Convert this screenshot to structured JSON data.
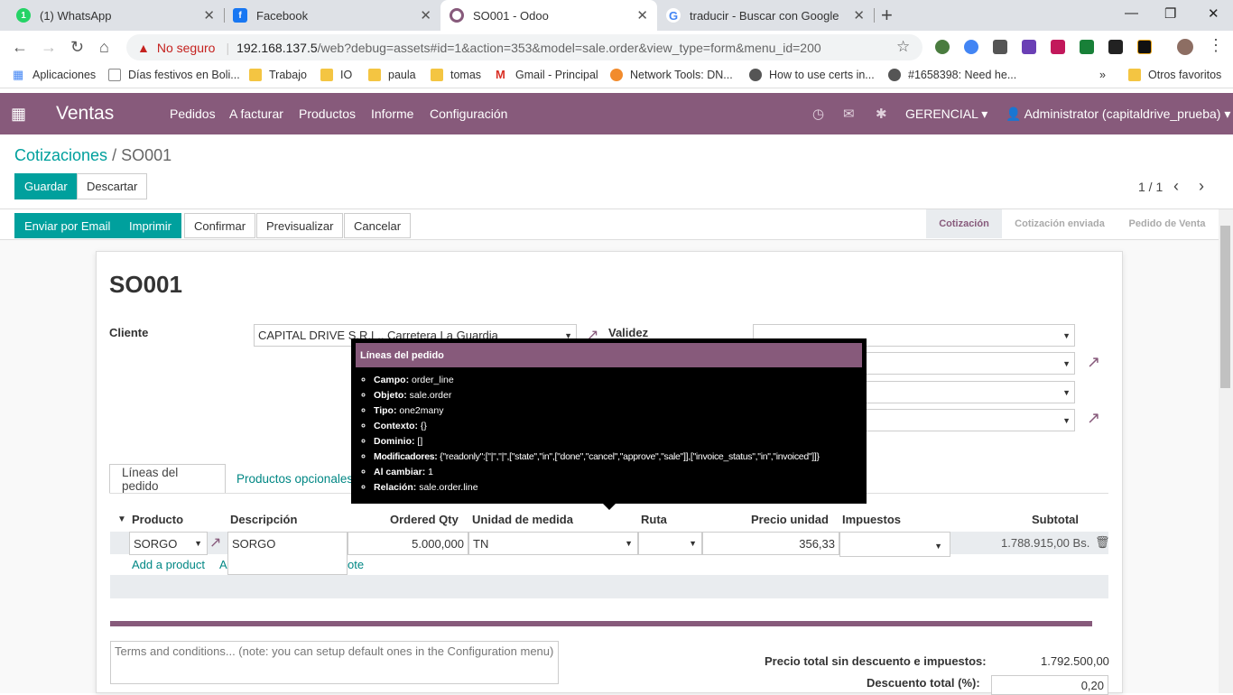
{
  "browser": {
    "tabs": [
      {
        "label": "(1) WhatsApp",
        "icon": "whatsapp-icon"
      },
      {
        "label": "Facebook",
        "icon": "facebook-icon"
      },
      {
        "label": "SO001 - Odoo",
        "icon": "odoo-icon"
      },
      {
        "label": "traducir - Buscar con Google",
        "icon": "google-icon"
      }
    ],
    "whatsapp_badge": "1",
    "security": "No seguro",
    "url_host": "192.168.137.5",
    "url_path": "/web?debug=assets#id=1&action=353&model=sale.order&view_type=form&menu_id=200",
    "bookmarks": [
      "Aplicaciones",
      "Días festivos en Boli...",
      "Trabajo",
      "IO",
      "paula",
      "tomas",
      "Gmail - Principal",
      "Network Tools: DN...",
      "How to use certs in...",
      "#1658398: Need he..."
    ],
    "more_bookmarks": "»",
    "other_favorites": "Otros favoritos"
  },
  "odoo": {
    "app": "Ventas",
    "menu": [
      "Pedidos",
      "A facturar",
      "Productos",
      "Informe",
      "Configuración"
    ],
    "company": "GERENCIAL",
    "user": "Administrator (capitaldrive_prueba)"
  },
  "breadcrumb": {
    "parent": "Cotizaciones",
    "sep": "/",
    "current": "SO001"
  },
  "buttons": {
    "save": "Guardar",
    "discard": "Descartar",
    "email": "Enviar por Email",
    "print": "Imprimir",
    "confirm": "Confirmar",
    "preview": "Previsualizar",
    "cancel": "Cancelar"
  },
  "pager": "1 / 1",
  "statusbar": [
    "Cotización",
    "Cotización enviada",
    "Pedido de Venta"
  ],
  "form": {
    "name": "SO001",
    "customer_label": "Cliente",
    "customer_value": "CAPITAL DRIVE S.R.L., Carretera La Guardia",
    "validity_label": "Validez"
  },
  "notebook": {
    "tabs": [
      "Líneas del pedido",
      "Productos opcionales"
    ]
  },
  "lines": {
    "headers": [
      "Producto",
      "Descripción",
      "Ordered Qty",
      "Unidad de medida",
      "Ruta",
      "Precio unidad",
      "Impuestos",
      "Subtotal"
    ],
    "row": {
      "product": "SORGO",
      "description": "SORGO",
      "qty": "5.000,000",
      "uom": "TN",
      "route": "",
      "price": "356,33",
      "taxes": "",
      "subtotal": "1.788.915,00 Bs."
    },
    "add_product": "Add a product",
    "add_section": "A",
    "add_note": "ote"
  },
  "terms_placeholder": "Terms and conditions... (note: you can setup default ones in the Configuration menu)",
  "totals": {
    "untaxed_label": "Precio total sin descuento e impuestos:",
    "untaxed_value": "1.792.500,00",
    "discount_label": "Descuento total (%):",
    "discount_value": "0,20"
  },
  "tooltip": {
    "title": "Líneas del pedido",
    "items": [
      {
        "k": "Campo",
        "v": "order_line"
      },
      {
        "k": "Objeto",
        "v": "sale.order"
      },
      {
        "k": "Tipo",
        "v": "one2many"
      },
      {
        "k": "Contexto",
        "v": "{}"
      },
      {
        "k": "Dominio",
        "v": "[]"
      },
      {
        "k": "Modificadores",
        "v": "{\"readonly\":[\"|\",\"|\",[\"state\",\"in\",[\"done\",\"cancel\",\"approve\",\"sale\"]],[\"invoice_status\",\"in\",\"invoiced\"]]}"
      },
      {
        "k": "Al cambiar",
        "v": "1"
      },
      {
        "k": "Relación",
        "v": "sale.order.line"
      }
    ]
  },
  "colors": {
    "brand": "#875a7b",
    "primary": "#00a09d"
  }
}
